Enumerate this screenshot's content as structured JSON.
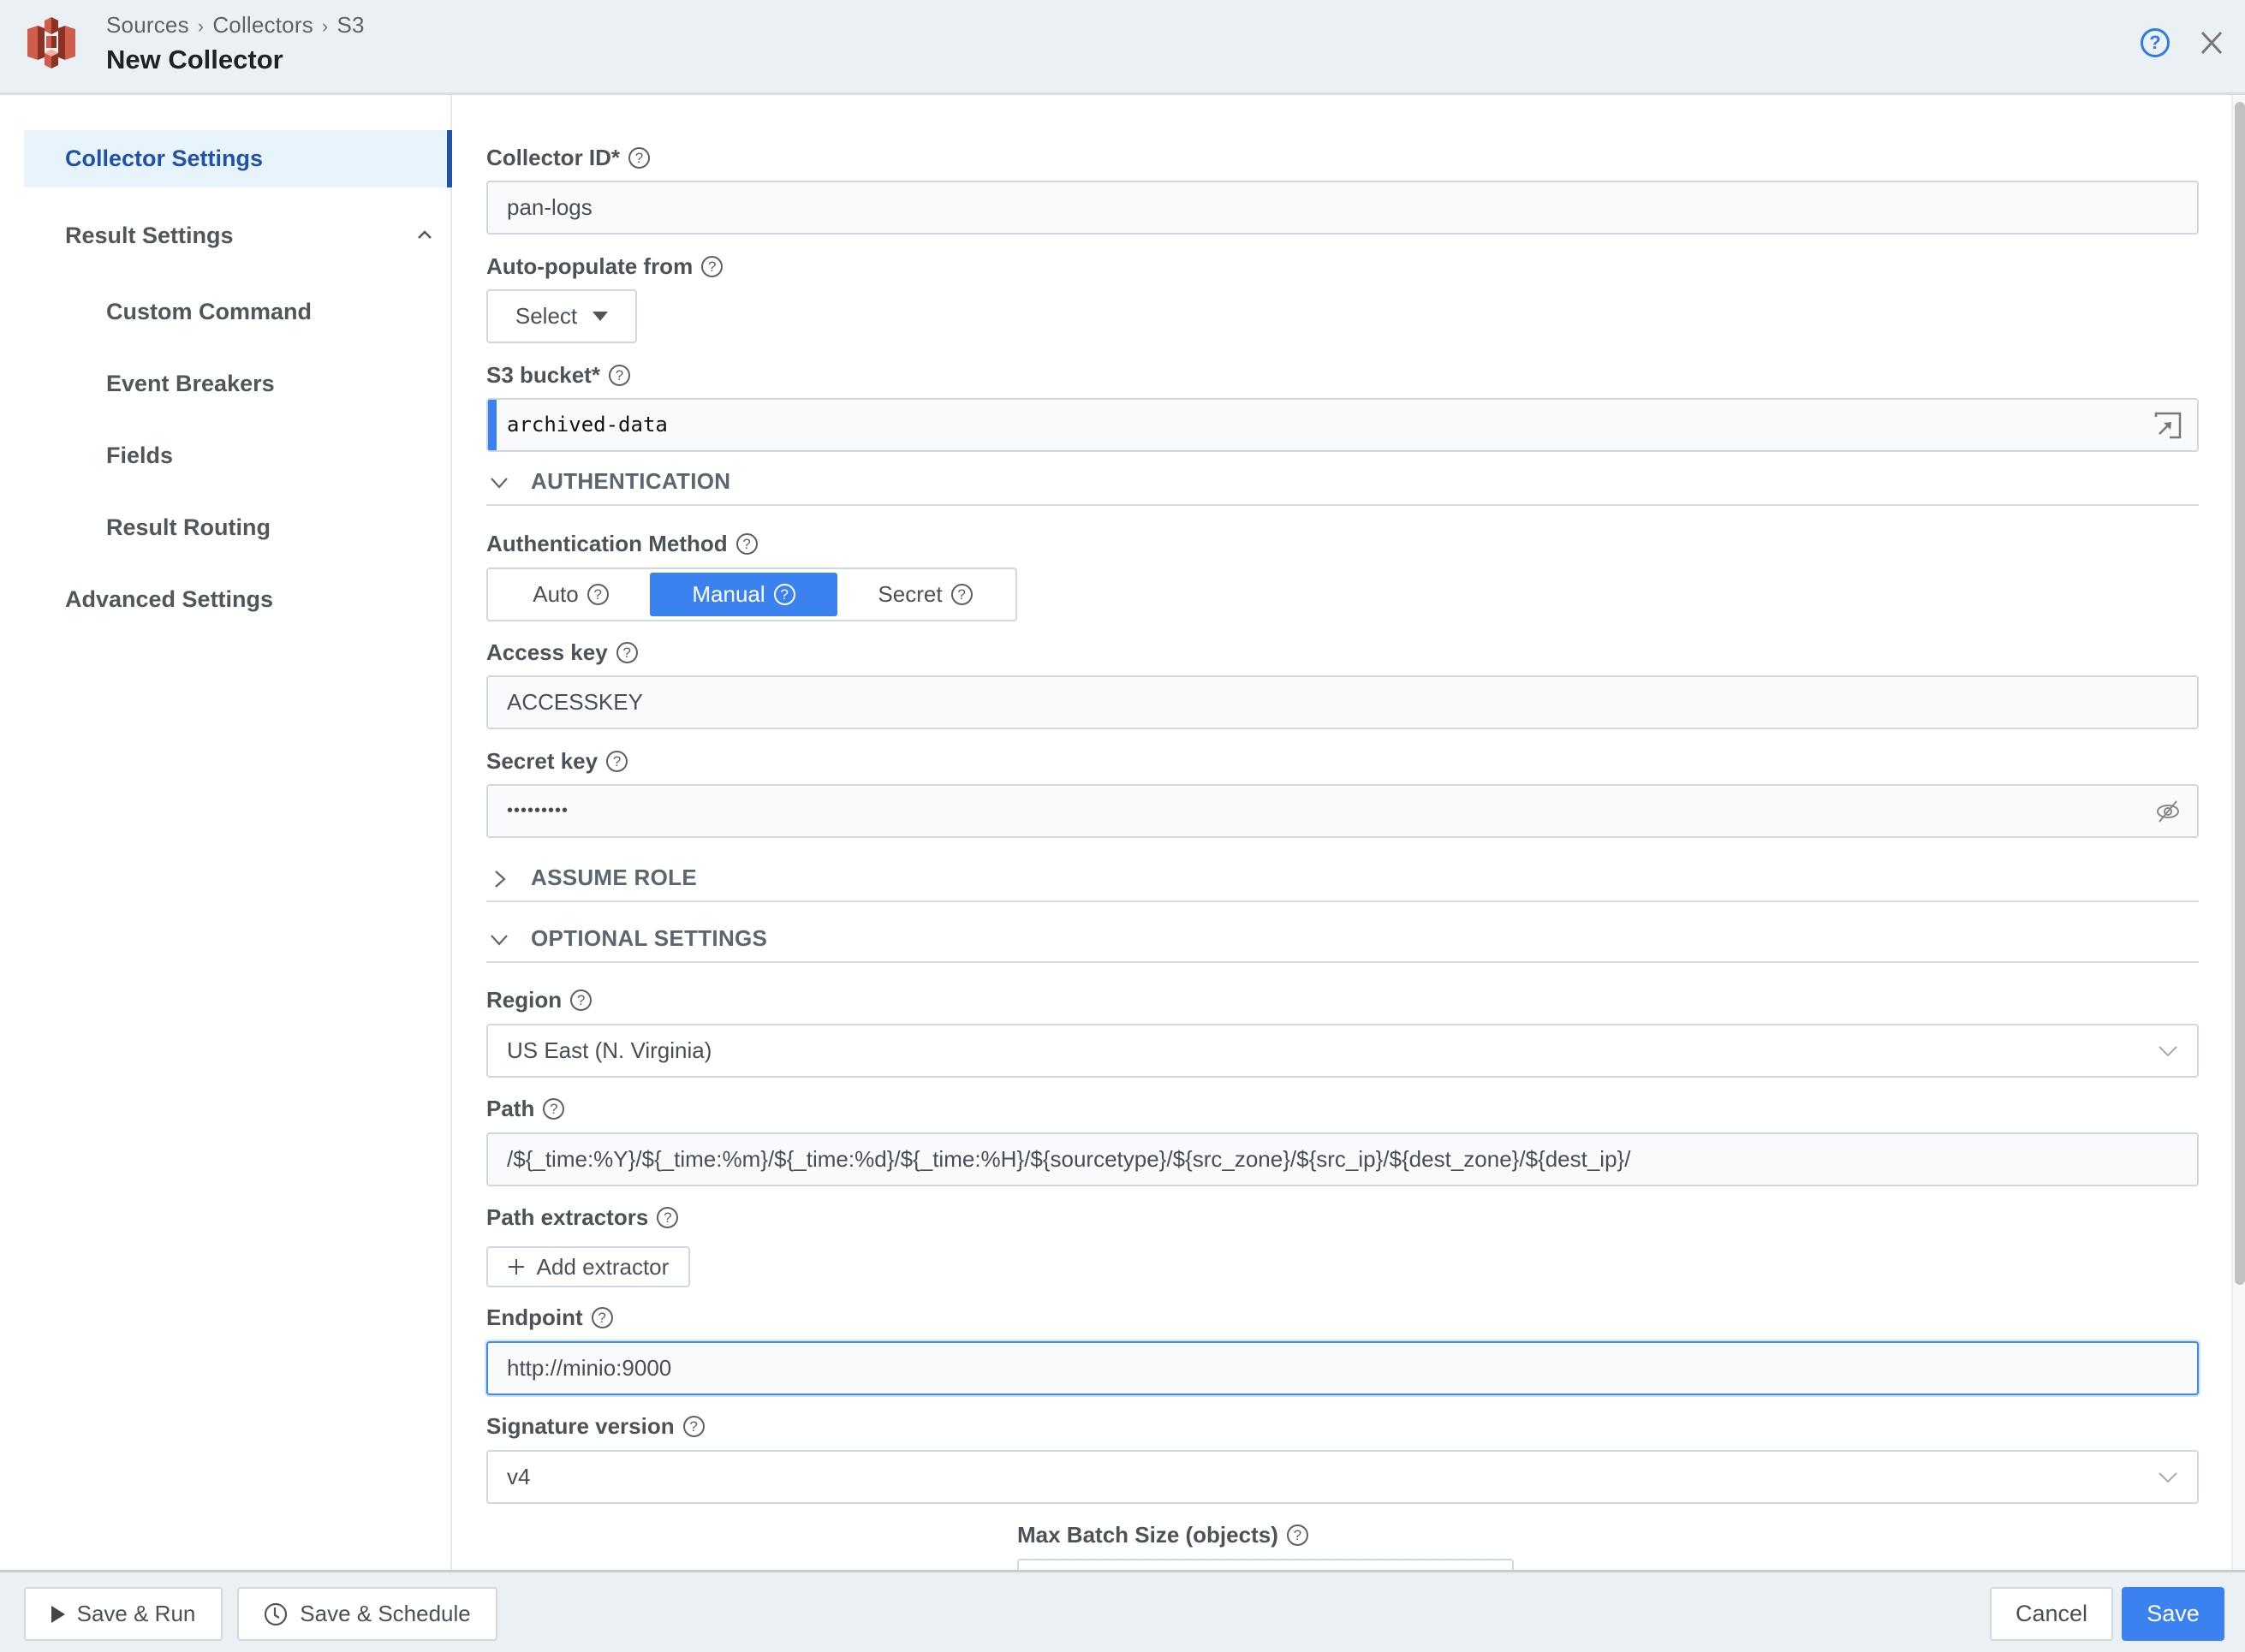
{
  "header": {
    "breadcrumbs": [
      "Sources",
      "Collectors",
      "S3"
    ],
    "breadcrumb_separator": "›",
    "title": "New Collector",
    "logo_icon": "aws-s3-logo-icon",
    "help_icon": "help-circle-icon",
    "close_icon": "close-icon",
    "help_glyph": "?"
  },
  "sidebar": {
    "items": [
      {
        "label": "Collector Settings",
        "active": true,
        "level": 0
      },
      {
        "label": "Result Settings",
        "active": false,
        "level": 0,
        "expanded": true
      },
      {
        "label": "Custom Command",
        "active": false,
        "level": 1
      },
      {
        "label": "Event Breakers",
        "active": false,
        "level": 1
      },
      {
        "label": "Fields",
        "active": false,
        "level": 1
      },
      {
        "label": "Result Routing",
        "active": false,
        "level": 1
      },
      {
        "label": "Advanced Settings",
        "active": false,
        "level": 0
      }
    ]
  },
  "form": {
    "help_glyph": "?",
    "collector_id": {
      "label": "Collector ID*",
      "value": "pan-logs"
    },
    "auto_populate": {
      "label": "Auto-populate from",
      "selected": "Select"
    },
    "s3_bucket": {
      "label": "S3 bucket*",
      "value": "archived-data"
    },
    "authentication": {
      "section_title": "AUTHENTICATION",
      "expanded": true,
      "method_label": "Authentication Method",
      "options": [
        "Auto",
        "Manual",
        "Secret"
      ],
      "selected": "Manual",
      "access_key": {
        "label": "Access key",
        "value": "ACCESSKEY"
      },
      "secret_key": {
        "label": "Secret key",
        "value": "•••••••••"
      }
    },
    "assume_role": {
      "section_title": "ASSUME ROLE",
      "expanded": false
    },
    "optional_settings": {
      "section_title": "OPTIONAL SETTINGS",
      "expanded": true,
      "region": {
        "label": "Region",
        "value": "US East (N. Virginia)"
      },
      "path": {
        "label": "Path",
        "value": "/${_time:%Y}/${_time:%m}/${_time:%d}/${_time:%H}/${sourcetype}/${src_zone}/${src_ip}/${dest_zone}/${dest_ip}/"
      },
      "path_extractors": {
        "label": "Path extractors",
        "add_button": "Add extractor"
      },
      "endpoint": {
        "label": "Endpoint",
        "value": "http://minio:9000"
      },
      "signature_version": {
        "label": "Signature version",
        "value": "v4"
      },
      "max_batch_size": {
        "label": "Max Batch Size (objects)",
        "value": ""
      }
    }
  },
  "footer": {
    "save_run": "Save & Run",
    "save_schedule": "Save & Schedule",
    "cancel": "Cancel",
    "save": "Save"
  },
  "colors": {
    "accent": "#3b82f0",
    "active_nav": "#2152a8",
    "header_bg": "#ebf0f5",
    "logo_red": "#d05c4b"
  }
}
